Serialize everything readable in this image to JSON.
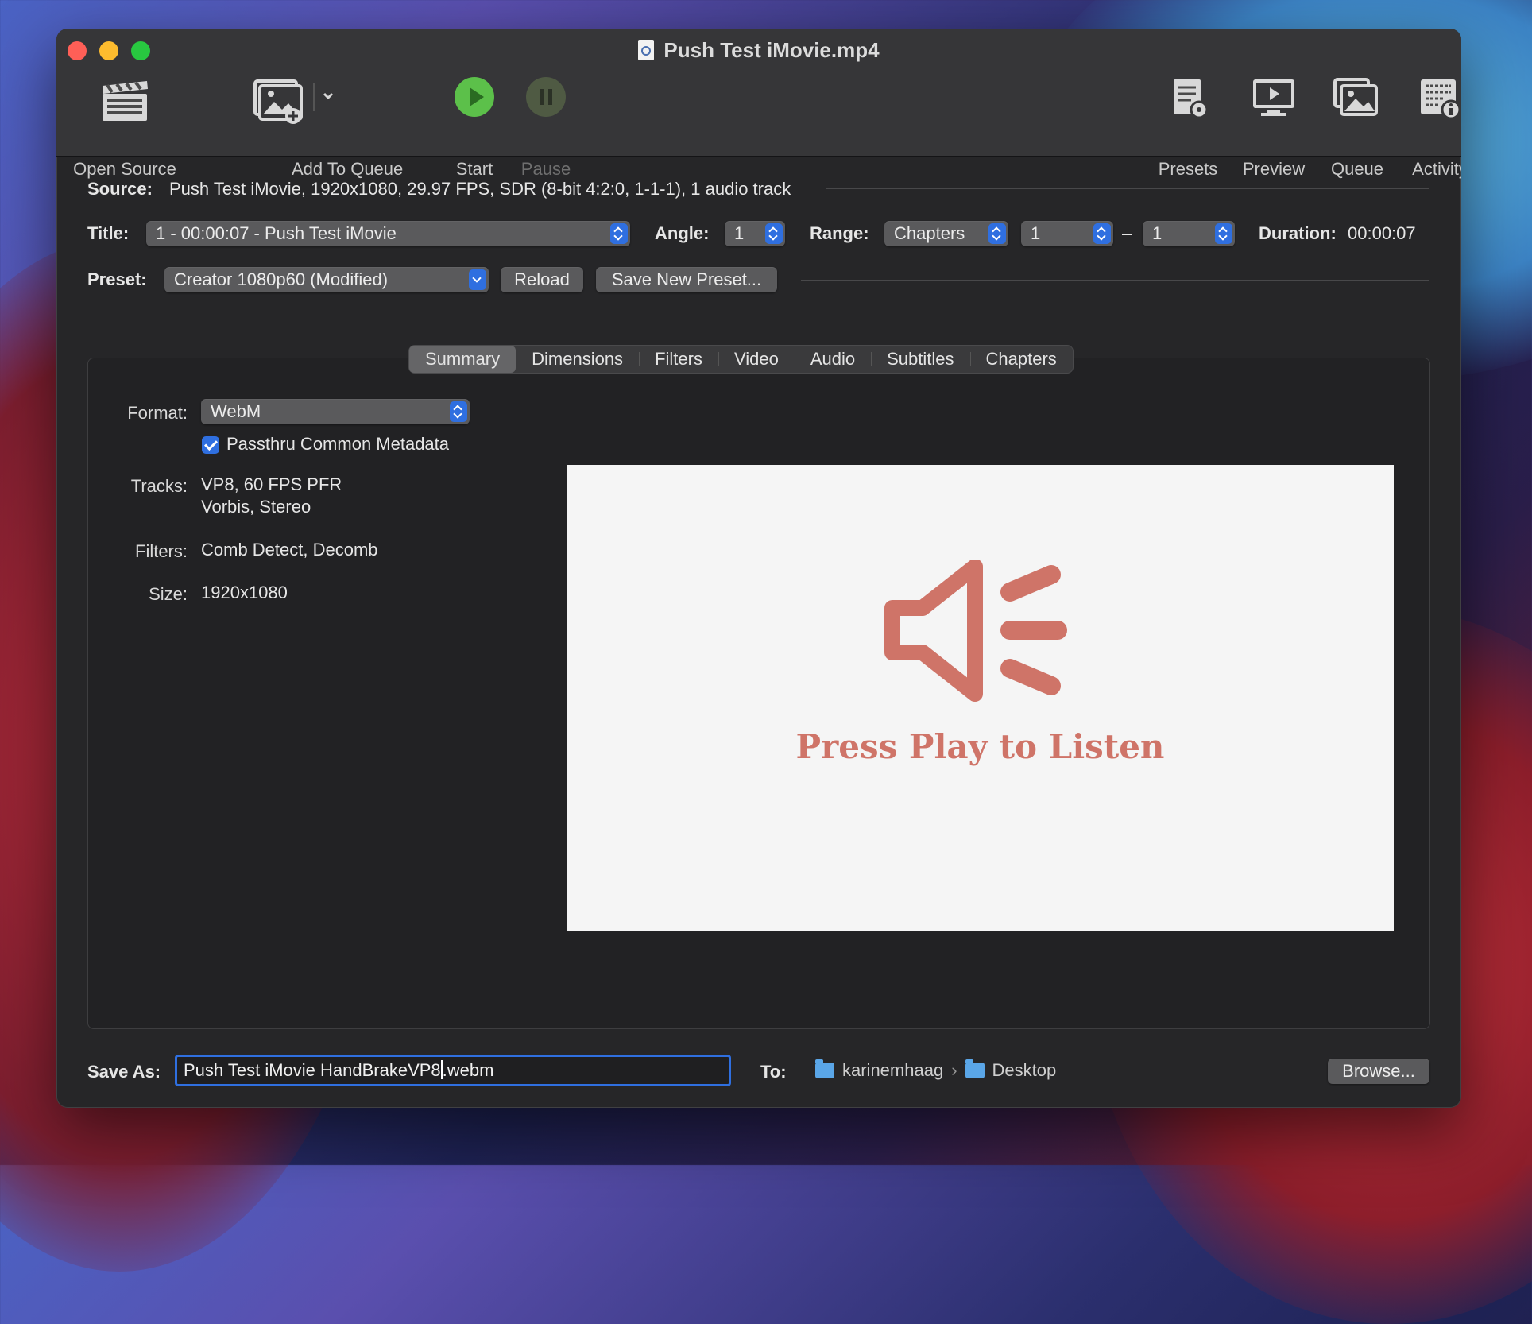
{
  "window": {
    "title": "Push Test iMovie.mp4"
  },
  "toolbar": {
    "open_source": "Open Source",
    "add_to_queue": "Add To Queue",
    "start": "Start",
    "pause": "Pause",
    "presets": "Presets",
    "preview": "Preview",
    "queue": "Queue",
    "activity": "Activity"
  },
  "source": {
    "label": "Source:",
    "value": "Push Test iMovie, 1920x1080, 29.97 FPS, SDR (8-bit 4:2:0, 1-1-1), 1 audio track"
  },
  "title_row": {
    "title_label": "Title:",
    "title_value": "1 - 00:00:07 - Push Test iMovie",
    "angle_label": "Angle:",
    "angle_value": "1",
    "range_label": "Range:",
    "range_type": "Chapters",
    "range_start": "1",
    "range_dash": "–",
    "range_end": "1",
    "duration_label": "Duration:",
    "duration_value": "00:00:07"
  },
  "preset_row": {
    "label": "Preset:",
    "value": "Creator 1080p60 (Modified)",
    "reload": "Reload",
    "save_new": "Save New Preset..."
  },
  "tabs": [
    "Summary",
    "Dimensions",
    "Filters",
    "Video",
    "Audio",
    "Subtitles",
    "Chapters"
  ],
  "active_tab": "Summary",
  "summary": {
    "format_label": "Format:",
    "format_value": "WebM",
    "passthru_label": "Passthru Common Metadata",
    "passthru_checked": true,
    "tracks_label": "Tracks:",
    "tracks_line1": "VP8, 60 FPS PFR",
    "tracks_line2": "Vorbis, Stereo",
    "filters_label": "Filters:",
    "filters_value": "Comb Detect, Decomb",
    "size_label": "Size:",
    "size_value": "1920x1080"
  },
  "preview": {
    "message": "Press Play to Listen",
    "icon": "speaker-icon",
    "accent": "#cf7468"
  },
  "save": {
    "label": "Save As:",
    "filename_before_caret": "Push Test iMovie HandBrakeVP8",
    "filename_after_caret": ".webm",
    "to_label": "To:",
    "path": [
      "karinemhaag",
      "Desktop"
    ],
    "browse": "Browse..."
  },
  "colors": {
    "accent": "#2f6fe0",
    "window_bg": "#262628",
    "start_green": "#5cc04a"
  }
}
